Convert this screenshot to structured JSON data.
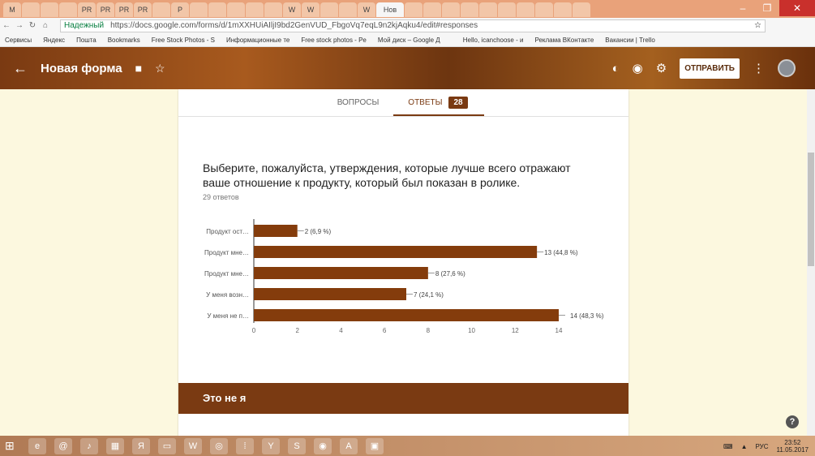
{
  "browser": {
    "tabs": [
      "M",
      "",
      "",
      "",
      "PR",
      "PR",
      "PR",
      "PR",
      "",
      "P",
      "",
      "",
      "",
      "",
      "",
      "W",
      "W",
      "",
      "",
      "W",
      "Нов",
      "",
      "",
      "",
      "",
      "",
      "",
      "",
      "",
      "",
      ""
    ],
    "active_tab": "Нов",
    "url_secure": "Надежный",
    "url": "https://docs.google.com/forms/d/1mXXHUiAIljI9bd2GenVUD_FbgoVq7eqL9n2kjAqku4/edit#responses",
    "bookmarks": [
      "Сервисы",
      "Яндекс",
      "Пошта",
      "Bookmarks",
      "Free Stock Photos - S",
      "Информационные те",
      "Free stock photos - Pe",
      "Мой диск – Google Д",
      "",
      "Hello, icanchoose - и",
      "Реклама ВКонтакте",
      "Вакансии | Trello"
    ]
  },
  "header": {
    "title": "Новая форма",
    "send": "ОТПРАВИТЬ"
  },
  "form_tabs": {
    "questions": "ВОПРОСЫ",
    "responses": "ОТВЕТЫ",
    "responses_count": "28"
  },
  "question": {
    "text": "Выберите, пожалуйста, утверждения, которые лучше всего отражают ваше отношение к продукту, который был показан в ролике.",
    "count": "29 ответов"
  },
  "chart_data": {
    "type": "bar",
    "orientation": "horizontal",
    "categories": [
      "Продукт ост…",
      "Продукт мне…",
      "Продукт мне…",
      "У меня возн…",
      "У меня не п…"
    ],
    "values": [
      2,
      13,
      8,
      7,
      14
    ],
    "labels": [
      "2 (6,9 %)",
      "13 (44,8 %)",
      "8 (27,6 %)",
      "7 (24,1 %)",
      "14 (48,3 %)"
    ],
    "xticks": [
      "0",
      "2",
      "4",
      "6",
      "8",
      "10",
      "12",
      "14"
    ],
    "xlim": [
      0,
      14
    ],
    "color": "#843c0c"
  },
  "section": {
    "title": "Это не я"
  },
  "help": "?",
  "taskbar": {
    "lang": "РУС",
    "time": "23:52",
    "date": "11.05.2017"
  }
}
